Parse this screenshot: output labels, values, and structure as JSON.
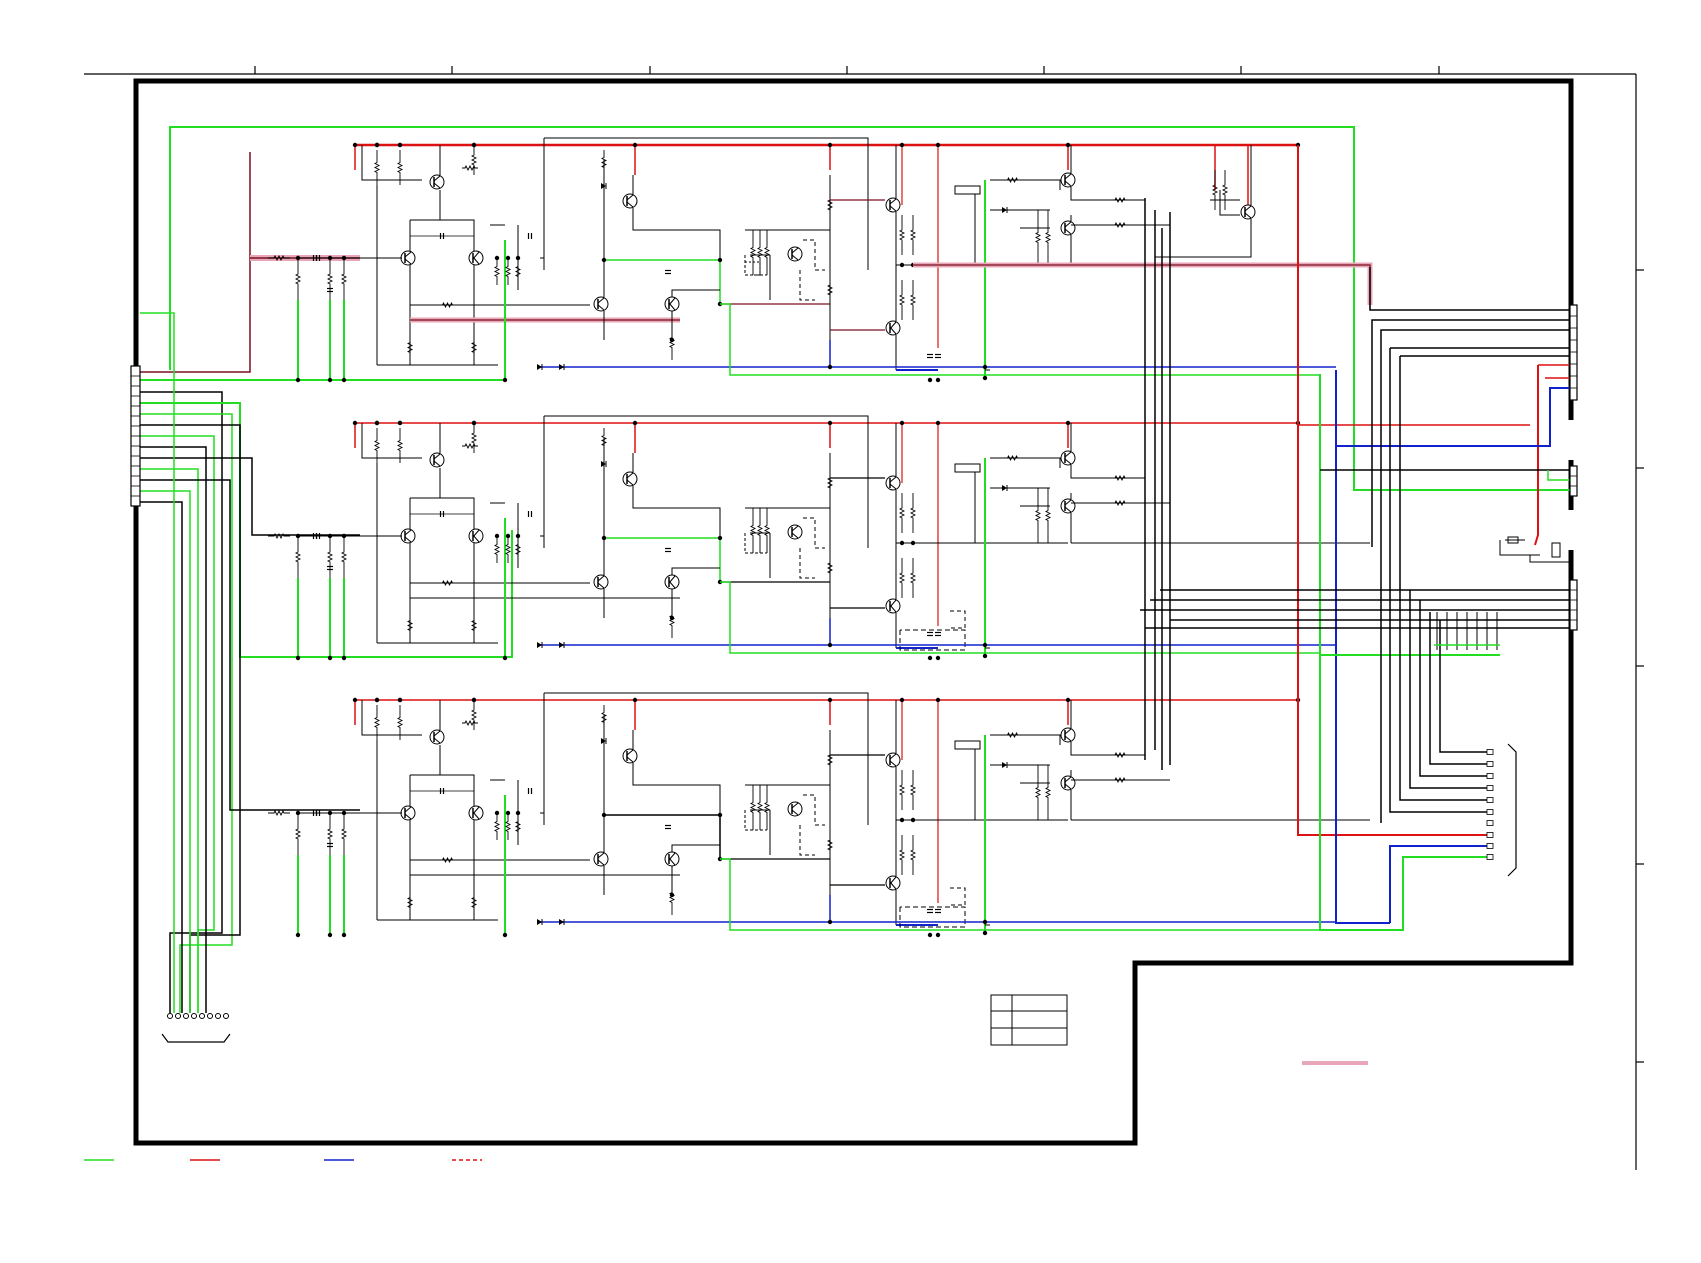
{
  "document": {
    "type": "circuit-schematic",
    "visible_text": []
  },
  "legend": {
    "items": [
      {
        "id": "ground-line",
        "color": "#22dd22",
        "style": "solid",
        "label": ""
      },
      {
        "id": "positive-supply-line",
        "color": "#dd1111",
        "style": "solid",
        "label": ""
      },
      {
        "id": "negative-supply-line",
        "color": "#1122cc",
        "style": "solid",
        "label": ""
      },
      {
        "id": "signal-path",
        "color": "#dd1111",
        "style": "dashed",
        "label": ""
      }
    ]
  },
  "colors": {
    "ground": "#22dd22",
    "positive_supply": "#dd1111",
    "negative_supply": "#1122cc",
    "signal_highlight": "#e8a6b8",
    "wire": "#000000",
    "border": "#000000"
  },
  "circuit": {
    "channels": [
      {
        "id": "channel-1"
      },
      {
        "id": "channel-2"
      },
      {
        "id": "channel-3"
      }
    ],
    "connectors": [
      {
        "id": "input-connector",
        "pins": 14
      },
      {
        "id": "output-connector-top",
        "pins": 8
      },
      {
        "id": "output-connector-mid",
        "pins": 4
      },
      {
        "id": "output-connector-bottom",
        "pins": 6
      },
      {
        "id": "bottom-cable",
        "pins": 8
      }
    ],
    "title_block": {
      "rows": 3,
      "cols": 2
    }
  }
}
